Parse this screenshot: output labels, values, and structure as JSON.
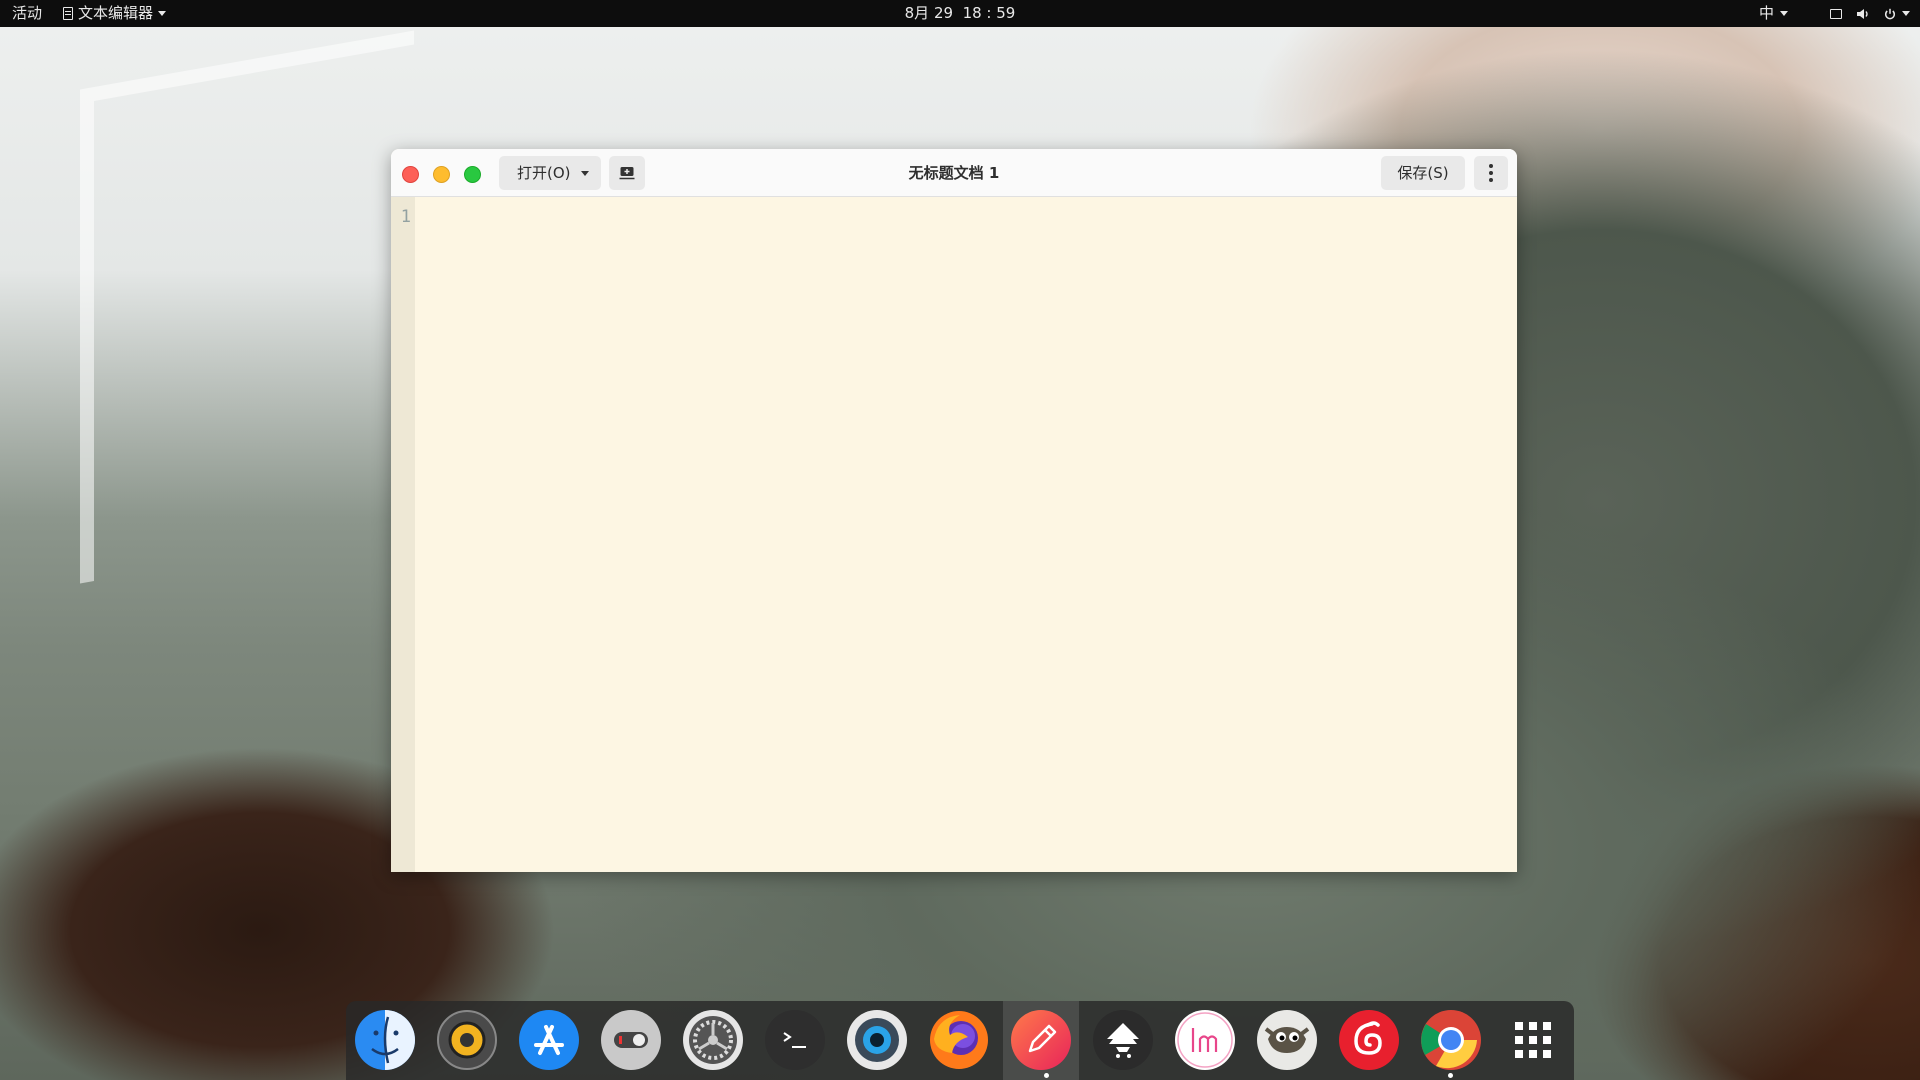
{
  "topbar": {
    "activities": "活动",
    "app_menu": "文本编辑器",
    "clock": "8月 29  18 : 59",
    "ime": "中"
  },
  "window": {
    "title": "无标题文档 1",
    "open_label": "打开(O)",
    "save_label": "保存(S)",
    "line_numbers": [
      "1"
    ]
  },
  "dock": {
    "items": [
      "finder-icon",
      "music-player-icon",
      "app-store-icon",
      "toggle-settings-icon",
      "system-settings-icon",
      "terminal-icon",
      "screenshot-icon",
      "firefox-icon",
      "text-editor-icon",
      "inkscape-icon",
      "lm-icon",
      "gimp-icon",
      "netease-music-icon",
      "chrome-icon",
      "app-grid-icon"
    ]
  },
  "colors": {
    "editor_bg": "#fdf6e3",
    "gutter_bg": "#eee8d5",
    "close": "#fd5f57",
    "minimize": "#febc2e",
    "maximize": "#29c840"
  }
}
